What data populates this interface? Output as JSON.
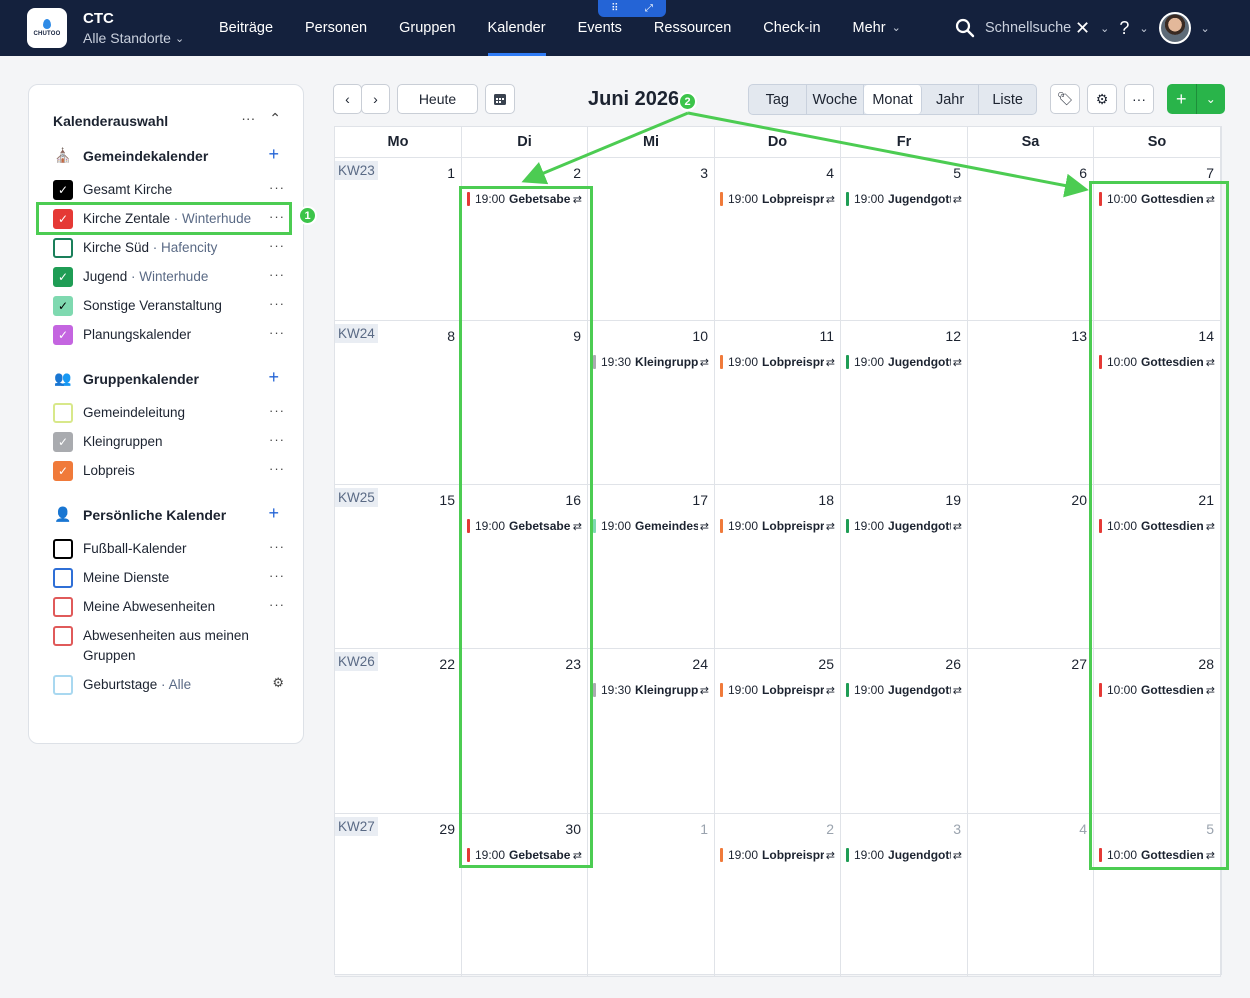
{
  "topbar": {
    "logo_text": "CHUTOO",
    "org_title": "CTC",
    "org_location": "Alle Standorte",
    "nav": [
      "Beiträge",
      "Personen",
      "Gruppen",
      "Kalender",
      "Events",
      "Ressourcen",
      "Check-in",
      "Mehr"
    ],
    "active_nav": "Kalender",
    "search_placeholder": "Schnellsuche"
  },
  "sidebar": {
    "title": "Kalenderauswahl",
    "sections": [
      {
        "title": "Gemeindekalender",
        "icon": "church-icon",
        "items": [
          {
            "label": "Gesamt Kirche",
            "sub": "",
            "checked": true,
            "color": "#000000"
          },
          {
            "label": "Kirche Zentale",
            "sub": "Winterhude",
            "checked": true,
            "color": "#e53935"
          },
          {
            "label": "Kirche Süd",
            "sub": "Hafencity",
            "checked": false,
            "color": "#1a7f5a"
          },
          {
            "label": "Jugend",
            "sub": "Winterhude",
            "checked": true,
            "color": "#1f9d55"
          },
          {
            "label": "Sonstige Veranstaltung",
            "sub": "",
            "checked": true,
            "color": "#7fd9b0"
          },
          {
            "label": "Planungskalender",
            "sub": "",
            "checked": true,
            "color": "#c465e0"
          }
        ]
      },
      {
        "title": "Gruppenkalender",
        "icon": "group-icon",
        "items": [
          {
            "label": "Gemeindeleitung",
            "sub": "",
            "checked": false,
            "color": "#d8e88a"
          },
          {
            "label": "Kleingruppen",
            "sub": "",
            "checked": true,
            "color": "#a9abaf"
          },
          {
            "label": "Lobpreis",
            "sub": "",
            "checked": true,
            "color": "#f07a3a"
          }
        ]
      },
      {
        "title": "Persönliche Kalender",
        "icon": "person-icon",
        "items": [
          {
            "label": "Fußball-Kalender",
            "sub": "",
            "checked": false,
            "color": "#000000"
          },
          {
            "label": "Meine Dienste",
            "sub": "",
            "checked": false,
            "color": "#2f6fd6"
          },
          {
            "label": "Meine Abwesenheiten",
            "sub": "",
            "checked": false,
            "color": "#e05a5a"
          },
          {
            "label": "Abwesenheiten aus meinen Gruppen",
            "sub": "",
            "checked": false,
            "color": "#e05a5a"
          },
          {
            "label": "Geburtstage",
            "sub": "Alle",
            "checked": false,
            "color": "#a9d8f0"
          }
        ]
      }
    ]
  },
  "toolbar": {
    "today_label": "Heute",
    "month_title": "Juni 2026",
    "views": [
      "Tag",
      "Woche",
      "Monat",
      "Jahr",
      "Liste"
    ],
    "active_view": "Monat"
  },
  "calendar": {
    "weekdays": [
      "Mo",
      "Di",
      "Mi",
      "Do",
      "Fr",
      "Sa",
      "So"
    ],
    "weeks": [
      {
        "kw": "KW23",
        "days": [
          {
            "n": "1"
          },
          {
            "n": "2",
            "ev": {
              "time": "19:00",
              "title": "Gebetsabend",
              "color": "#e53935"
            }
          },
          {
            "n": "3"
          },
          {
            "n": "4",
            "ev": {
              "time": "19:00",
              "title": "Lobpreisprobe",
              "color": "#f07a3a"
            }
          },
          {
            "n": "5",
            "ev": {
              "time": "19:00",
              "title": "Jugendgottesdienst",
              "color": "#1f9d55"
            }
          },
          {
            "n": "6"
          },
          {
            "n": "7",
            "ev": {
              "time": "10:00",
              "title": "Gottesdienst",
              "color": "#e53935"
            }
          }
        ]
      },
      {
        "kw": "KW24",
        "days": [
          {
            "n": "8"
          },
          {
            "n": "9"
          },
          {
            "n": "10",
            "ev": {
              "time": "19:30",
              "title": "Kleingruppe",
              "color": "#a9abaf"
            }
          },
          {
            "n": "11",
            "ev": {
              "time": "19:00",
              "title": "Lobpreisprobe",
              "color": "#f07a3a"
            }
          },
          {
            "n": "12",
            "ev": {
              "time": "19:00",
              "title": "Jugendgottesdienst",
              "color": "#1f9d55"
            }
          },
          {
            "n": "13"
          },
          {
            "n": "14",
            "ev": {
              "time": "10:00",
              "title": "Gottesdienst",
              "color": "#e53935"
            }
          }
        ]
      },
      {
        "kw": "KW25",
        "days": [
          {
            "n": "15"
          },
          {
            "n": "16",
            "ev": {
              "time": "19:00",
              "title": "Gebetsabend",
              "color": "#e53935"
            }
          },
          {
            "n": "17",
            "ev": {
              "time": "19:00",
              "title": "Gemeindesitzung",
              "color": "#7fd9b0"
            }
          },
          {
            "n": "18",
            "ev": {
              "time": "19:00",
              "title": "Lobpreisprobe",
              "color": "#f07a3a"
            }
          },
          {
            "n": "19",
            "ev": {
              "time": "19:00",
              "title": "Jugendgottesdienst",
              "color": "#1f9d55"
            }
          },
          {
            "n": "20"
          },
          {
            "n": "21",
            "ev": {
              "time": "10:00",
              "title": "Gottesdienst",
              "color": "#e53935"
            }
          }
        ]
      },
      {
        "kw": "KW26",
        "days": [
          {
            "n": "22"
          },
          {
            "n": "23"
          },
          {
            "n": "24",
            "ev": {
              "time": "19:30",
              "title": "Kleingruppe",
              "color": "#a9abaf"
            }
          },
          {
            "n": "25",
            "ev": {
              "time": "19:00",
              "title": "Lobpreisprobe",
              "color": "#f07a3a"
            }
          },
          {
            "n": "26",
            "ev": {
              "time": "19:00",
              "title": "Jugendgottesdienst",
              "color": "#1f9d55"
            }
          },
          {
            "n": "27"
          },
          {
            "n": "28",
            "ev": {
              "time": "10:00",
              "title": "Gottesdienst",
              "color": "#e53935"
            }
          }
        ]
      },
      {
        "kw": "KW27",
        "days": [
          {
            "n": "29"
          },
          {
            "n": "30",
            "ev": {
              "time": "19:00",
              "title": "Gebetsabend",
              "color": "#e53935"
            }
          },
          {
            "n": "1",
            "dim": true
          },
          {
            "n": "2",
            "dim": true,
            "ev": {
              "time": "19:00",
              "title": "Lobpreisprobe",
              "color": "#f07a3a"
            }
          },
          {
            "n": "3",
            "dim": true,
            "ev": {
              "time": "19:00",
              "title": "Jugendgottesdienst",
              "color": "#1f9d55"
            }
          },
          {
            "n": "4",
            "dim": true
          },
          {
            "n": "5",
            "dim": true,
            "ev": {
              "time": "10:00",
              "title": "Gottesdienst",
              "color": "#e53935"
            }
          }
        ]
      }
    ]
  },
  "annotations": {
    "badge1": "1",
    "badge2": "2",
    "color": "#4ccc52"
  }
}
